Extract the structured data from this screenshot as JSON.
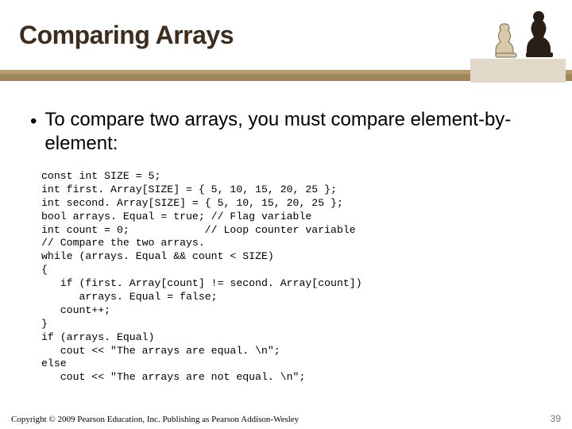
{
  "header": {
    "title": "Comparing Arrays"
  },
  "bullet": {
    "text": "To compare two arrays, you must compare element-by-element:"
  },
  "code": {
    "text": "const int SIZE = 5;\nint first. Array[SIZE] = { 5, 10, 15, 20, 25 };\nint second. Array[SIZE] = { 5, 10, 15, 20, 25 };\nbool arrays. Equal = true; // Flag variable\nint count = 0;            // Loop counter variable\n// Compare the two arrays.\nwhile (arrays. Equal && count < SIZE)\n{\n   if (first. Array[count] != second. Array[count])\n      arrays. Equal = false;\n   count++;\n}\nif (arrays. Equal)\n   cout << \"The arrays are equal. \\n\";\nelse\n   cout << \"The arrays are not equal. \\n\";"
  },
  "footer": {
    "copyright": "Copyright © 2009 Pearson Education, Inc. Publishing as Pearson Addison-Wesley",
    "pagenum": "39"
  }
}
